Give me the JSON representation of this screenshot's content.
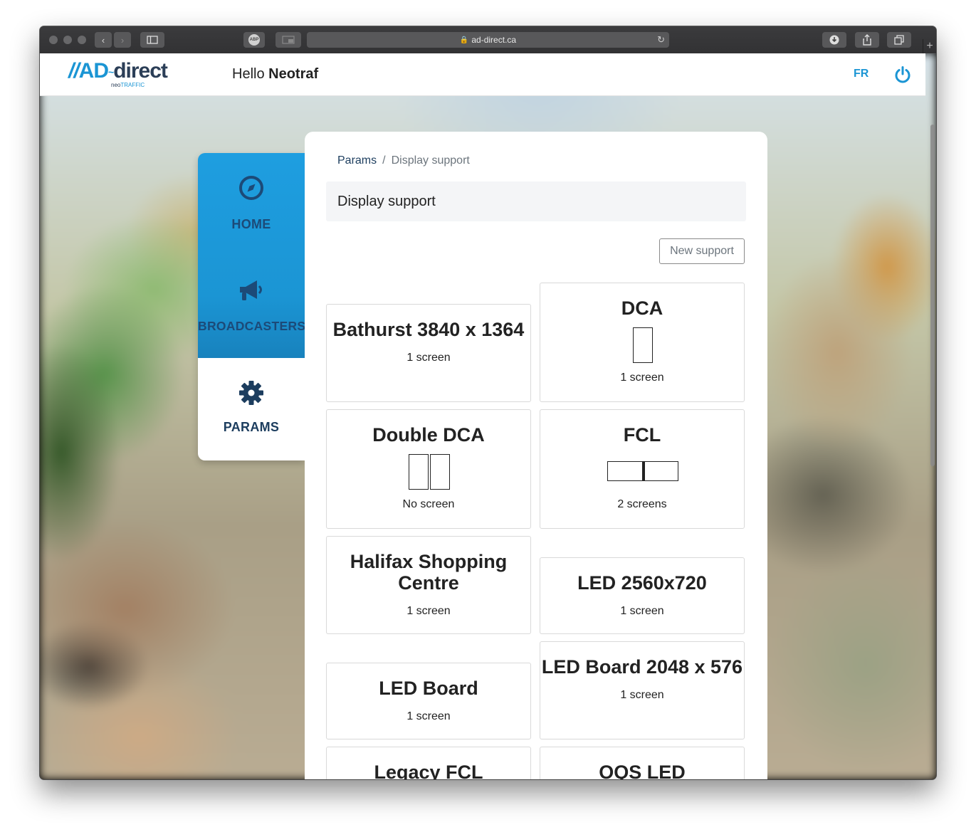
{
  "browser": {
    "address": "ad-direct.ca",
    "abp_label": "ABP"
  },
  "header": {
    "logo_ad": "AD",
    "logo_direct": "direct",
    "logo_neo": "neo",
    "logo_traffic": "TRAFFIC",
    "greeting": "Hello",
    "username": "Neotraf",
    "lang_toggle": "FR"
  },
  "sidebar": {
    "items": [
      {
        "label": "HOME",
        "icon": "compass-icon"
      },
      {
        "label": "BROADCASTERS",
        "icon": "megaphone-icon"
      },
      {
        "label": "PARAMS",
        "icon": "gear-icon",
        "active": true
      }
    ]
  },
  "main": {
    "breadcrumb": {
      "root": "Params",
      "separator": "/",
      "current": "Display support"
    },
    "title": "Display support",
    "new_button": "New support",
    "cards": [
      {
        "title": "Bathurst 3840 x 1364",
        "screens": "1 screen"
      },
      {
        "title": "DCA",
        "screens": "1 screen"
      },
      {
        "title": "Double DCA",
        "screens": "No screen"
      },
      {
        "title": "FCL",
        "screens": "2 screens"
      },
      {
        "title": "Halifax Shopping Centre",
        "screens": "1 screen"
      },
      {
        "title": "LED 2560x720",
        "screens": "1 screen"
      },
      {
        "title": "LED Board",
        "screens": "1 screen"
      },
      {
        "title": "LED Board 2048 x 576",
        "screens": "1 screen"
      },
      {
        "title": "Legacy FCL",
        "screens": ""
      },
      {
        "title": "OQS LED",
        "screens": ""
      }
    ]
  },
  "colors": {
    "brand_blue": "#1b95d4",
    "navy": "#1c3d5e"
  }
}
